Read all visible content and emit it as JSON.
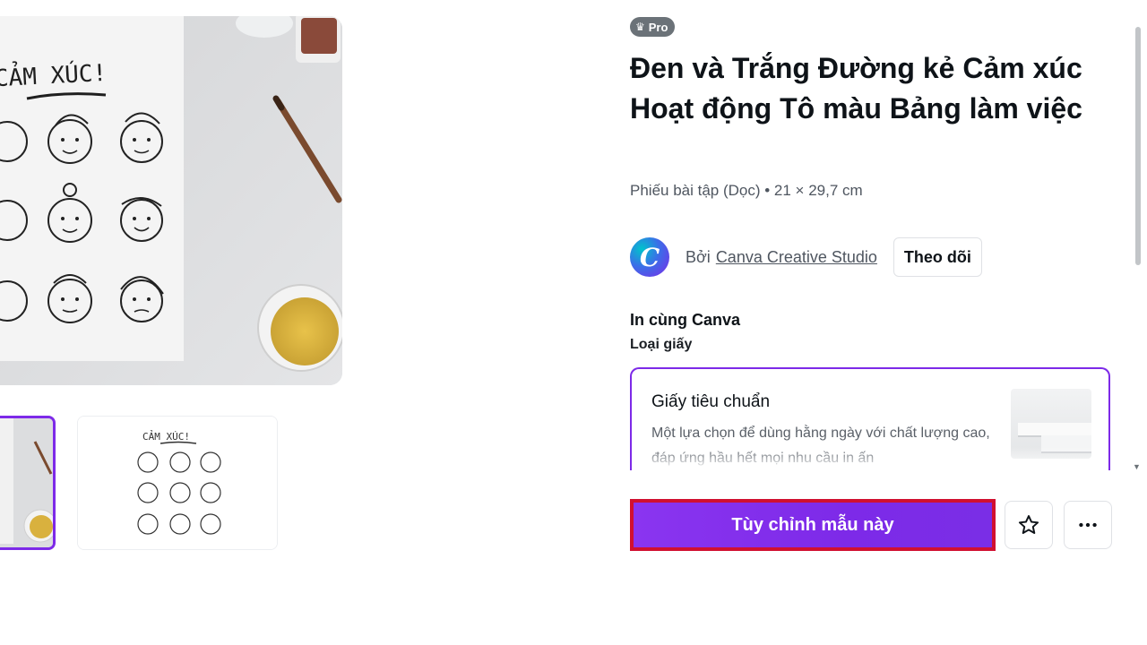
{
  "badge": {
    "icon": "crown-icon",
    "label": "Pro"
  },
  "template": {
    "title": "Đen và Trắng Đường kẻ Cảm xúc Hoạt động Tô màu Bảng làm việc",
    "meta": "Phiếu bài tập (Dọc) • 21 × 29,7 cm"
  },
  "author": {
    "avatar_letter": "C",
    "prefix": "Bởi",
    "name": "Canva Creative Studio",
    "follow_label": "Theo dõi"
  },
  "print": {
    "title": "In cùng Canva",
    "paper_type_label": "Loại giấy",
    "selected_paper": {
      "name": "Giấy tiêu chuẩn",
      "description": "Một lựa chọn để dùng hằng ngày với chất lượng cao, đáp ứng hầu hết mọi nhu cầu in ấn"
    }
  },
  "preview": {
    "heading_text": "CẢM XÚC!",
    "thumb_heading_text": "CẢM XÚC!"
  },
  "actions": {
    "customize_label": "Tùy chỉnh mẫu này",
    "favorite_icon": "star-icon",
    "more_icon": "more-horizontal-icon"
  },
  "colors": {
    "accent": "#7d2ae8",
    "highlight_border": "#d11030",
    "badge_bg": "#6b7278"
  }
}
